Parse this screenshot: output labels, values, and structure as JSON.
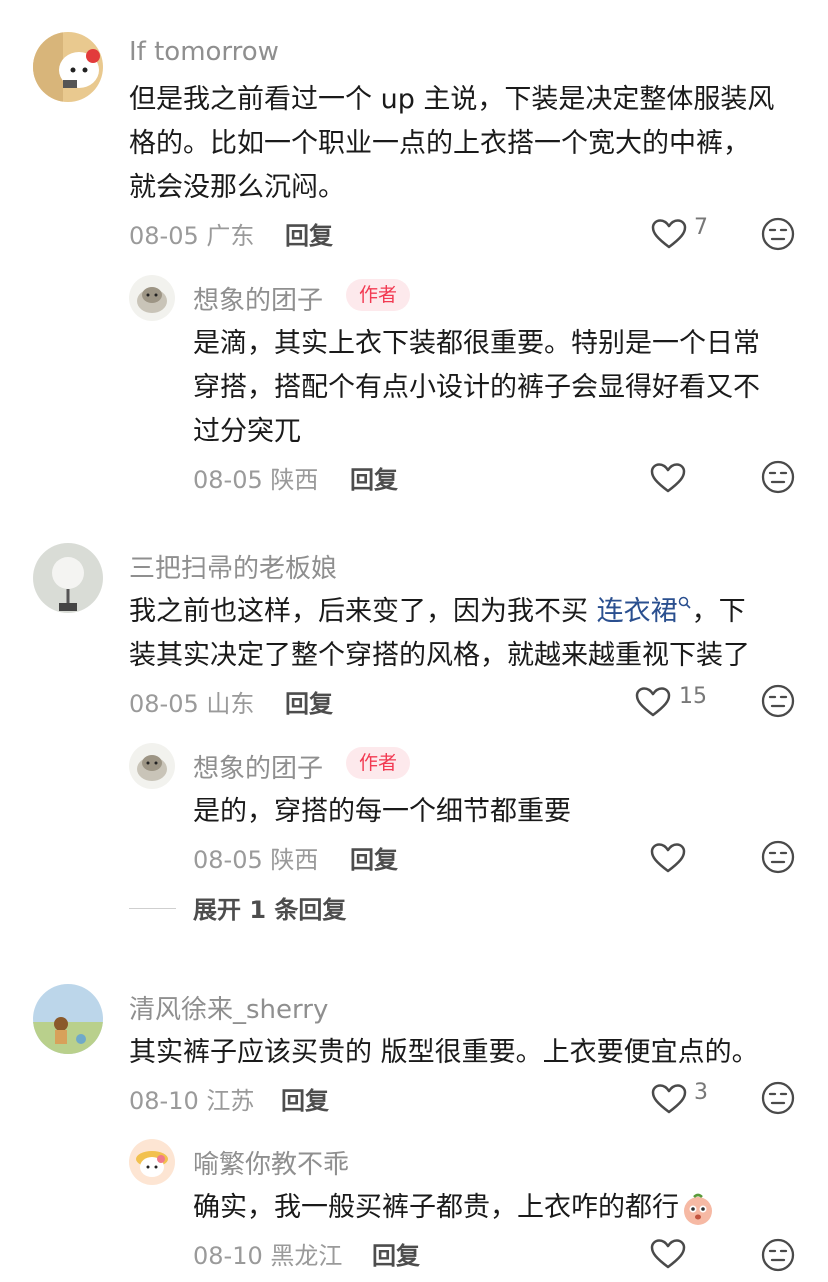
{
  "comments": [
    {
      "user": "If tomorrow",
      "text_lines": [
        "但是我之前看过一个 up 主说，下装是决定整体服装风",
        "格的。比如一个职业一点的上衣搭一个宽大的中裤，",
        "就会没那么沉闷。"
      ],
      "date": "08-05",
      "location": "广东",
      "likes": "7",
      "replies": [
        {
          "user": "想象的团子",
          "badge": "作者",
          "text_lines": [
            "是滴，其实上衣下装都很重要。特别是一个日常",
            "穿搭，搭配个有点小设计的裤子会显得好看又不",
            "过分突兀"
          ],
          "date": "08-05",
          "location": "陕西",
          "likes": ""
        }
      ]
    },
    {
      "user": "三把扫帚的老板娘",
      "text_prefix": "我之前也这样，后来变了，因为我不买 ",
      "text_link": "连衣裙",
      "text_suffix": "，下",
      "text_line2": "装其实决定了整个穿搭的风格，就越来越重视下装了",
      "date": "08-05",
      "location": "山东",
      "likes": "15",
      "replies": [
        {
          "user": "想象的团子",
          "badge": "作者",
          "text": "是的，穿搭的每一个细节都重要",
          "date": "08-05",
          "location": "陕西",
          "likes": ""
        }
      ],
      "expand_label": "展开 1 条回复"
    },
    {
      "user": "清风徐来_sherry",
      "text": "其实裤子应该买贵的  版型很重要。上衣要便宜点的。",
      "date": "08-10",
      "location": "江苏",
      "likes": "3",
      "replies": [
        {
          "user": "喻繁你教不乖",
          "text": "确实，我一般买裤子都贵，上衣咋的都行",
          "date": "08-10",
          "location": "黑龙江",
          "likes": ""
        }
      ]
    }
  ],
  "reply_label": "回复",
  "icons": {
    "like": "heart-icon",
    "dislike": "unamused-face-icon",
    "search": "search-icon",
    "emoji": "crying-face-emoji"
  },
  "colors": {
    "badge_text": "#f23a52",
    "badge_bg": "#fde9ec",
    "link": "#2a4f8f"
  }
}
